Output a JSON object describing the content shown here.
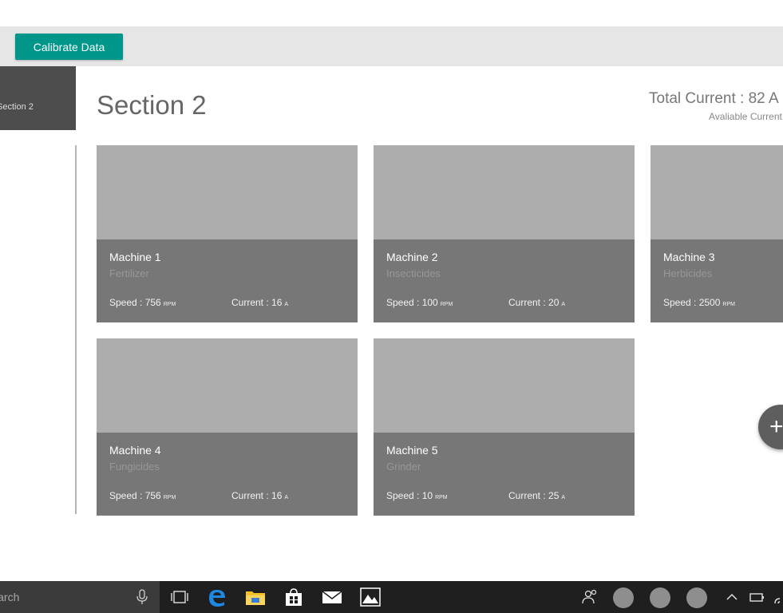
{
  "toolbar": {
    "calibrate_label": "Calibrate Data"
  },
  "sidebar": {
    "tab_label": "Section 2"
  },
  "header": {
    "title": "Section 2",
    "total_current": "Total Current : 82 A",
    "available_current": "Avaliable Current"
  },
  "machines": [
    {
      "name": "Machine 1",
      "type": "Fertilizer",
      "speed": "Speed : 756",
      "speed_unit": "RPM",
      "current": "Current  : 16",
      "current_unit": "A"
    },
    {
      "name": "Machine 2",
      "type": "Insecticides",
      "speed": "Speed : 100",
      "speed_unit": "RPM",
      "current": "Current  : 20",
      "current_unit": "A"
    },
    {
      "name": "Machine 3",
      "type": "Herbicides",
      "speed": "Speed : 2500",
      "speed_unit": "RPM"
    },
    {
      "name": "Machine 4",
      "type": "Fungicides",
      "speed": "Speed : 756",
      "speed_unit": "RPM",
      "current": "Current  : 16",
      "current_unit": "A"
    },
    {
      "name": "Machine 5",
      "type": "Grinder",
      "speed": "Speed : 10",
      "speed_unit": "RPM",
      "current": "Current  : 25",
      "current_unit": "A"
    }
  ],
  "fab": {
    "label": "+"
  },
  "taskbar": {
    "search_text": "Search",
    "icons": [
      "microphone-icon",
      "task-view-icon",
      "edge-icon",
      "file-explorer-icon",
      "store-icon",
      "mail-icon",
      "photos-icon",
      "people-icon",
      "chevron-up-icon",
      "battery-icon",
      "wifi-icon"
    ]
  },
  "colors": {
    "accent": "#00968a",
    "card_image": "#adadad",
    "card_info": "#777777",
    "taskbar": "#1f1f1f"
  }
}
